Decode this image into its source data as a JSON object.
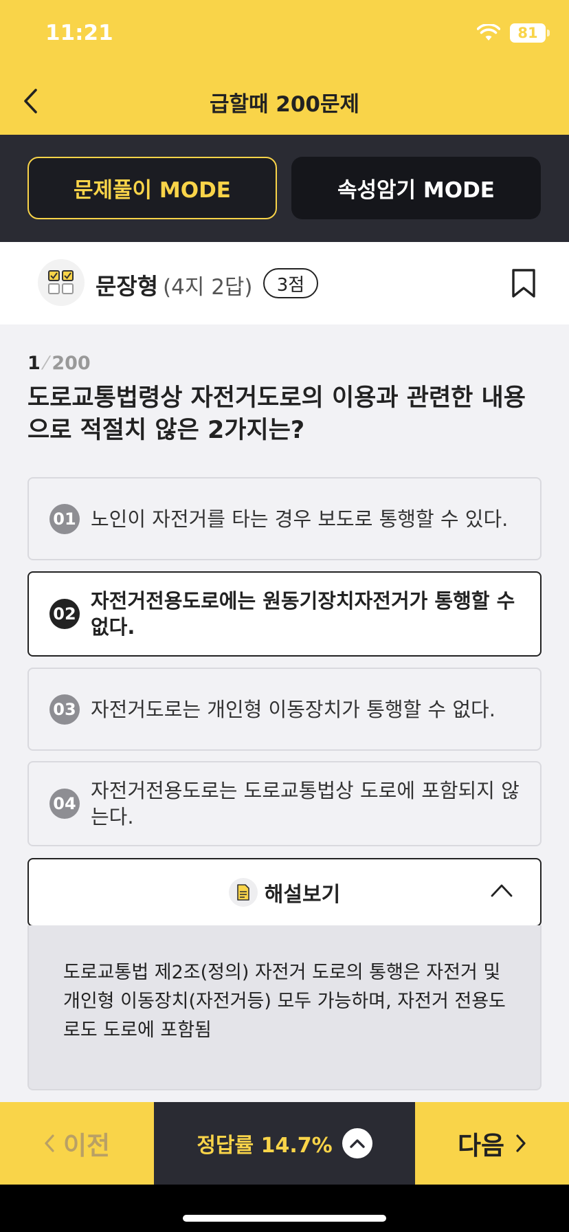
{
  "status_bar": {
    "time": "11:21",
    "battery": "81"
  },
  "header": {
    "title": "급할때 200문제"
  },
  "modes": [
    {
      "label": "문제풀이 MODE",
      "active": true
    },
    {
      "label": "속성암기 MODE",
      "active": false
    }
  ],
  "question_type": {
    "label": "문장형",
    "sub": "(4지 2답)",
    "points": "3점"
  },
  "progress": {
    "current": "1",
    "separator": "⁄",
    "total": "200"
  },
  "question": "도로교통법령상 자전거도로의 이용과 관련한 내용으로 적절치 않은 2가지는?",
  "options": [
    {
      "num": "01",
      "text": "노인이 자전거를 타는 경우 보도로 통행할 수 있다.",
      "selected": false
    },
    {
      "num": "02",
      "text": "자전거전용도로에는 원동기장치자전거가 통행할 수 없다.",
      "selected": true
    },
    {
      "num": "03",
      "text": "자전거도로는 개인형 이동장치가 통행할 수 없다.",
      "selected": false
    },
    {
      "num": "04",
      "text": "자전거전용도로는 도로교통법상 도로에 포함되지 않는다.",
      "selected": false
    }
  ],
  "explanation": {
    "label": "해설보기",
    "text": "도로교통법 제2조(정의) 자전거 도로의 통행은 자전거 및 개인형 이동장치(자전거등) 모두 가능하며, 자전거 전용도 로도 도로에 포함됨"
  },
  "bottom": {
    "prev_label": "이전",
    "rate_label": "정답률 14.7%",
    "next_label": "다음"
  },
  "colors": {
    "accent": "#F9D449",
    "dark": "#2A2B33",
    "text": "#222222"
  }
}
